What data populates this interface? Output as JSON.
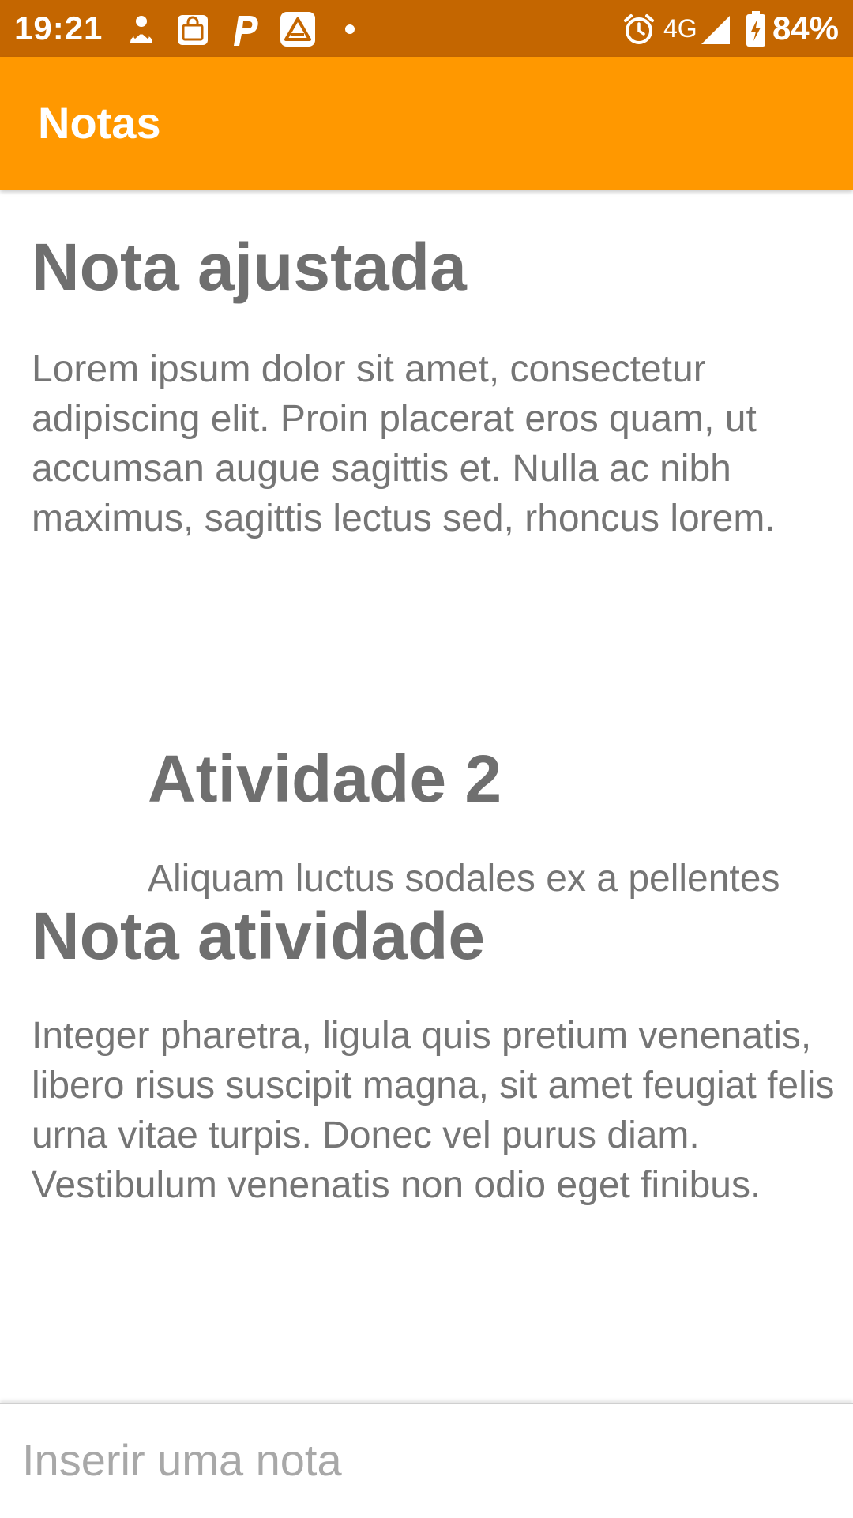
{
  "status_bar": {
    "time": "19:21",
    "network": "4G",
    "battery": "84%",
    "icons": [
      "person-notification-icon",
      "shopping-bag-icon",
      "p-app-icon",
      "triangle-app-icon",
      "dot-icon",
      "alarm-icon",
      "signal-icon",
      "battery-charging-icon"
    ]
  },
  "app_bar": {
    "title": "Notas"
  },
  "notes": [
    {
      "title": "Nota ajustada",
      "body": "Lorem ipsum dolor sit amet, consectetur adipiscing elit. Proin placerat eros quam, ut accumsan augue sagittis et. Nulla ac nibh maximus, sagittis lectus sed, rhoncus lorem."
    },
    {
      "title": "Atividade 2",
      "body": "Aliquam luctus sodales ex a pellentes"
    },
    {
      "title": "Nota atividade",
      "body": "Integer pharetra, ligula quis pretium venenatis, libero risus suscipit magna, sit amet feugiat felis urna vitae turpis. Donec vel purus diam. Vestibulum venenatis non odio eget finibus."
    }
  ],
  "input": {
    "placeholder": "Inserir uma nota"
  },
  "colors": {
    "status_bar": "#c46600",
    "app_bar": "#ff9800",
    "text": "#6f6f6f"
  }
}
